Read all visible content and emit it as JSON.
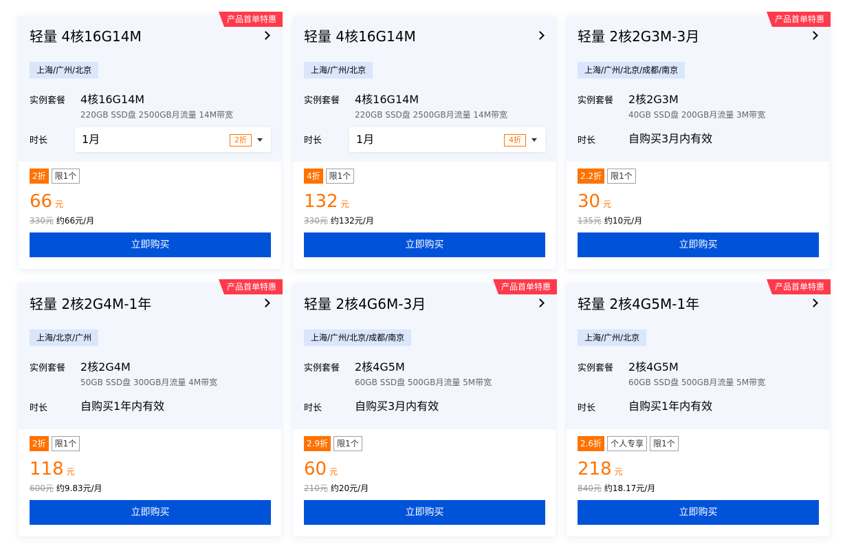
{
  "cards": [
    {
      "ribbon": "产品首单特惠",
      "title": "轻量 4核16G14M",
      "regions": "上海/广州/北京",
      "spec_label": "实例套餐",
      "spec_name": "4核16G14M",
      "spec_desc": "220GB SSD盘 2500GB月流量 14M带宽",
      "duration_label": "时长",
      "duration_value": "1月",
      "duration_badge": "2折",
      "discount_tag": "2折",
      "tags": [
        "限1个"
      ],
      "price": "66",
      "price_unit": "元",
      "original_price": "330元",
      "monthly": "约66元/月",
      "buy_label": "立即购买"
    },
    {
      "ribbon": "",
      "title": "轻量 4核16G14M",
      "regions": "上海/广州/北京",
      "spec_label": "实例套餐",
      "spec_name": "4核16G14M",
      "spec_desc": "220GB SSD盘 2500GB月流量 14M带宽",
      "duration_label": "时长",
      "duration_value": "1月",
      "duration_badge": "4折",
      "discount_tag": "4折",
      "tags": [
        "限1个"
      ],
      "price": "132",
      "price_unit": "元",
      "original_price": "330元",
      "monthly": "约132元/月",
      "buy_label": "立即购买"
    },
    {
      "ribbon": "产品首单特惠",
      "title": "轻量 2核2G3M-3月",
      "regions": "上海/广州/北京/成都/南京",
      "spec_label": "实例套餐",
      "spec_name": "2核2G3M",
      "spec_desc": "40GB SSD盘 200GB月流量 3M带宽",
      "duration_label": "时长",
      "duration_value": "自购买3月内有效",
      "discount_tag": "2.2折",
      "tags": [
        "限1个"
      ],
      "price": "30",
      "price_unit": "元",
      "original_price": "135元",
      "monthly": "约10元/月",
      "buy_label": "立即购买"
    },
    {
      "ribbon": "产品首单特惠",
      "title": "轻量 2核2G4M-1年",
      "regions": "上海/北京/广州",
      "spec_label": "实例套餐",
      "spec_name": "2核2G4M",
      "spec_desc": "50GB SSD盘 300GB月流量 4M带宽",
      "duration_label": "时长",
      "duration_value": "自购买1年内有效",
      "discount_tag": "2折",
      "tags": [
        "限1个"
      ],
      "price": "118",
      "price_unit": "元",
      "original_price": "600元",
      "monthly": "约9.83元/月",
      "buy_label": "立即购买"
    },
    {
      "ribbon": "产品首单特惠",
      "title": "轻量 2核4G6M-3月",
      "regions": "上海/广州/北京/成都/南京",
      "spec_label": "实例套餐",
      "spec_name": "2核4G5M",
      "spec_desc": "60GB SSD盘 500GB月流量 5M带宽",
      "duration_label": "时长",
      "duration_value": "自购买3月内有效",
      "discount_tag": "2.9折",
      "tags": [
        "限1个"
      ],
      "price": "60",
      "price_unit": "元",
      "original_price": "210元",
      "monthly": "约20元/月",
      "buy_label": "立即购买"
    },
    {
      "ribbon": "产品首单特惠",
      "title": "轻量 2核4G5M-1年",
      "regions": "上海/广州/北京",
      "spec_label": "实例套餐",
      "spec_name": "2核4G5M",
      "spec_desc": "60GB SSD盘 500GB月流量 5M带宽",
      "duration_label": "时长",
      "duration_value": "自购买1年内有效",
      "discount_tag": "2.6折",
      "tags": [
        "个人专享",
        "限1个"
      ],
      "price": "218",
      "price_unit": "元",
      "original_price": "840元",
      "monthly": "约18.17元/月",
      "buy_label": "立即购买"
    }
  ]
}
